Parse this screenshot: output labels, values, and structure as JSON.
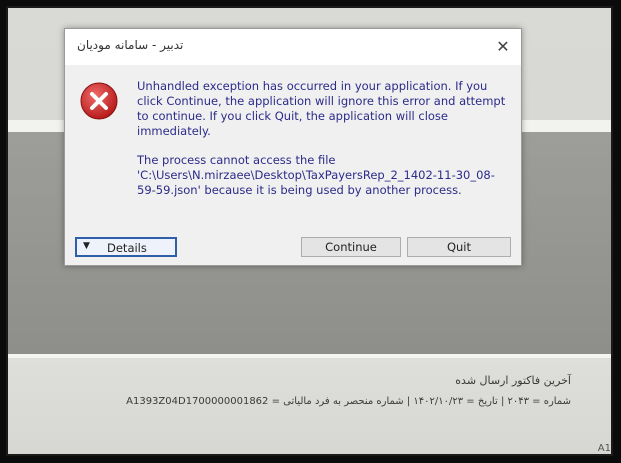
{
  "dialog": {
    "title": "تدبیر - سامانه مودیان",
    "close_symbol": "✕",
    "message_1": "Unhandled exception has occurred in your application. If you click Continue, the application will ignore this error and attempt to continue. If you click Quit, the application will close immediately.",
    "message_2": "The process cannot access the file 'C:\\Users\\N.mirzaee\\Desktop\\TaxPayersRep_2_1402-11-30_08-59-59.json' because it is being used by another process.",
    "details_label": "Details",
    "continue_label": "Continue",
    "quit_label": "Quit",
    "icon": "error-icon"
  },
  "background": {
    "info_title": "آخرین فاکتور ارسال شده",
    "info_line": "شماره = ۲۰۴۳ | تاریخ = ۱۴۰۲/۱۰/۲۳ | شماره منحصر به فرد مالیاتی = A1393Z04D1700000001862",
    "corner_label": "A1"
  },
  "colors": {
    "message_text": "#2b2b8a",
    "error_red": "#c8282a",
    "focus_border": "#2e5fa8"
  }
}
